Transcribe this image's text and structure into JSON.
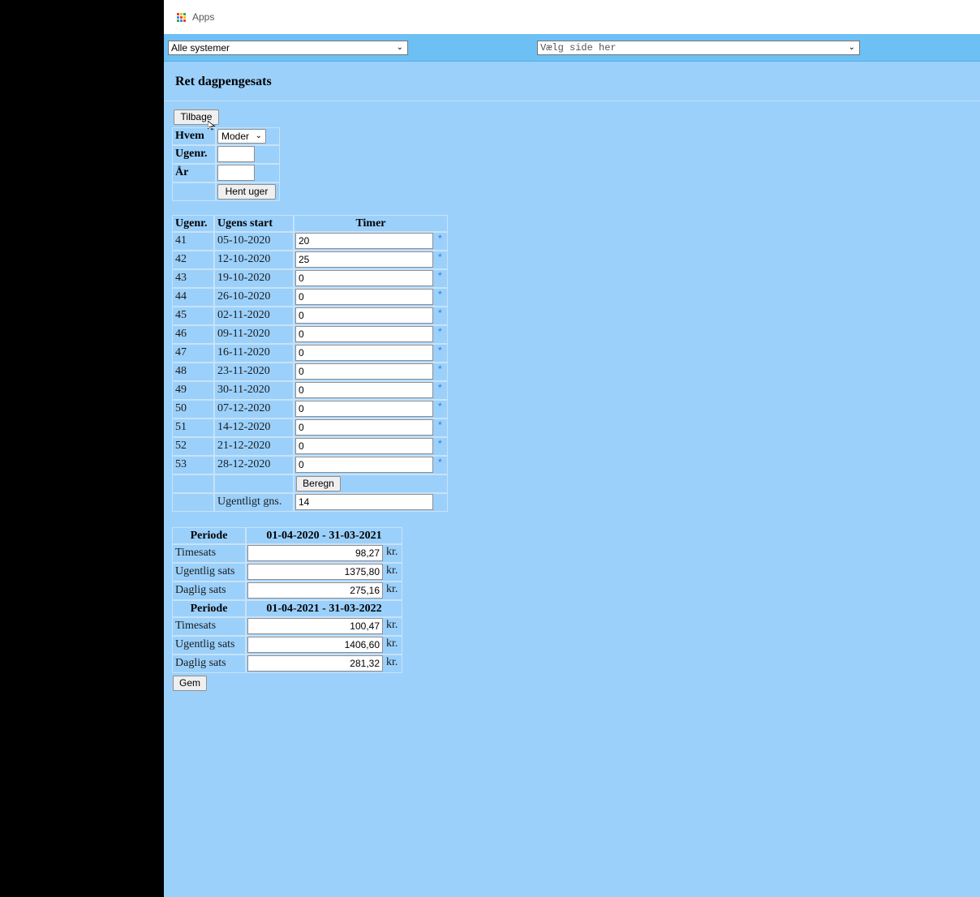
{
  "bookmarks": {
    "apps_label": "Apps"
  },
  "top_selects": {
    "system": "Alle systemer",
    "page": "Vælg side her"
  },
  "page_title": "Ret dagpengesats",
  "buttons": {
    "back": "Tilbage",
    "fetch_weeks": "Hent uger",
    "calculate": "Beregn",
    "save": "Gem"
  },
  "filter": {
    "who_label": "Hvem",
    "who_value": "Moder",
    "week_label": "Ugenr.",
    "week_value": "",
    "year_label": "År",
    "year_value": ""
  },
  "weeks_table": {
    "headers": [
      "Ugenr.",
      "Ugens start",
      "Timer"
    ],
    "rows": [
      {
        "week": "41",
        "start": "05-10-2020",
        "hours": "20"
      },
      {
        "week": "42",
        "start": "12-10-2020",
        "hours": "25"
      },
      {
        "week": "43",
        "start": "19-10-2020",
        "hours": "0"
      },
      {
        "week": "44",
        "start": "26-10-2020",
        "hours": "0"
      },
      {
        "week": "45",
        "start": "02-11-2020",
        "hours": "0"
      },
      {
        "week": "46",
        "start": "09-11-2020",
        "hours": "0"
      },
      {
        "week": "47",
        "start": "16-11-2020",
        "hours": "0"
      },
      {
        "week": "48",
        "start": "23-11-2020",
        "hours": "0"
      },
      {
        "week": "49",
        "start": "30-11-2020",
        "hours": "0"
      },
      {
        "week": "50",
        "start": "07-12-2020",
        "hours": "0"
      },
      {
        "week": "51",
        "start": "14-12-2020",
        "hours": "0"
      },
      {
        "week": "52",
        "start": "21-12-2020",
        "hours": "0"
      },
      {
        "week": "53",
        "start": "28-12-2020",
        "hours": "0"
      }
    ],
    "required_marker": "*",
    "average_label": "Ugentligt gns.",
    "average_value": "14"
  },
  "rates": {
    "period_label": "Periode",
    "unit": "kr.",
    "periods": [
      {
        "range": "01-04-2020 - 31-03-2021",
        "rows": [
          {
            "label": "Timesats",
            "value": "98,27"
          },
          {
            "label": "Ugentlig sats",
            "value": "1375,80"
          },
          {
            "label": "Daglig sats",
            "value": "275,16"
          }
        ]
      },
      {
        "range": "01-04-2021 - 31-03-2022",
        "rows": [
          {
            "label": "Timesats",
            "value": "100,47"
          },
          {
            "label": "Ugentlig sats",
            "value": "1406,60"
          },
          {
            "label": "Daglig sats",
            "value": "281,32"
          }
        ]
      }
    ]
  },
  "colors": {
    "page_bg": "#9bd0fb",
    "system_bar": "#6cc0f3",
    "asterisk": "#2a7ee0"
  }
}
